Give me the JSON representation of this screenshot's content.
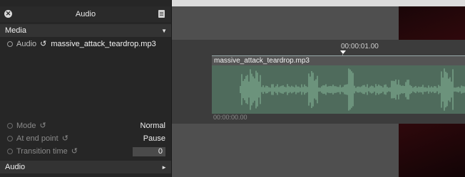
{
  "panel": {
    "title": "Audio",
    "media_section": "Media",
    "audio_label": "Audio",
    "audio_file": "massive_attack_teardrop.mp3",
    "mode_label": "Mode",
    "mode_value": "Normal",
    "end_label": "At end point",
    "end_value": "Pause",
    "transition_label": "Transition time",
    "transition_value": "0",
    "audio_section": "Audio"
  },
  "timeline": {
    "playhead_time": "00:00:01.00",
    "clip_name": "massive_attack_teardrop.mp3",
    "clip_start": "00:00:00.00"
  },
  "colors": {
    "panel_bg": "#262626",
    "section_bg": "#333333",
    "clip_wave": "#7fae92",
    "video_accent": "#3a0a0e"
  }
}
